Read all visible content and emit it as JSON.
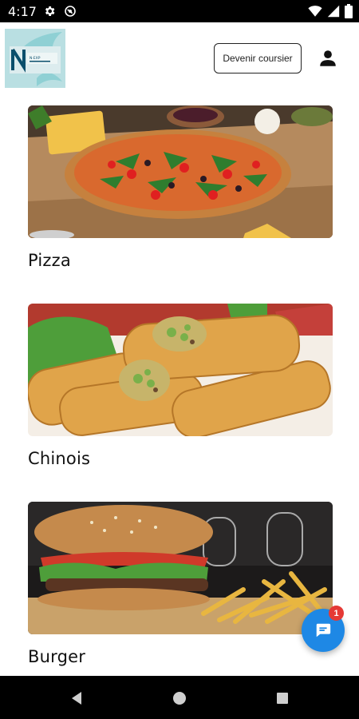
{
  "status_bar": {
    "time": "4:17",
    "icons": [
      "gear-icon",
      "at-sign-icon",
      "wifi-icon",
      "signal-icon",
      "battery-icon"
    ]
  },
  "header": {
    "logo_icon": "brand-logo",
    "courier_button_label": "Devenir coursier",
    "account_icon": "person-icon"
  },
  "categories": [
    {
      "title": "Pizza",
      "image": "pizza-photo"
    },
    {
      "title": "Chinois",
      "image": "spring-rolls-photo"
    },
    {
      "title": "Burger",
      "image": "burger-fries-photo"
    }
  ],
  "chat": {
    "icon": "chat-bubble-icon",
    "badge_count": "1",
    "accent_color": "#1e88e5",
    "badge_color": "#e53935"
  },
  "nav_bar": {
    "icons": [
      "back-icon",
      "home-icon",
      "recents-icon"
    ]
  }
}
